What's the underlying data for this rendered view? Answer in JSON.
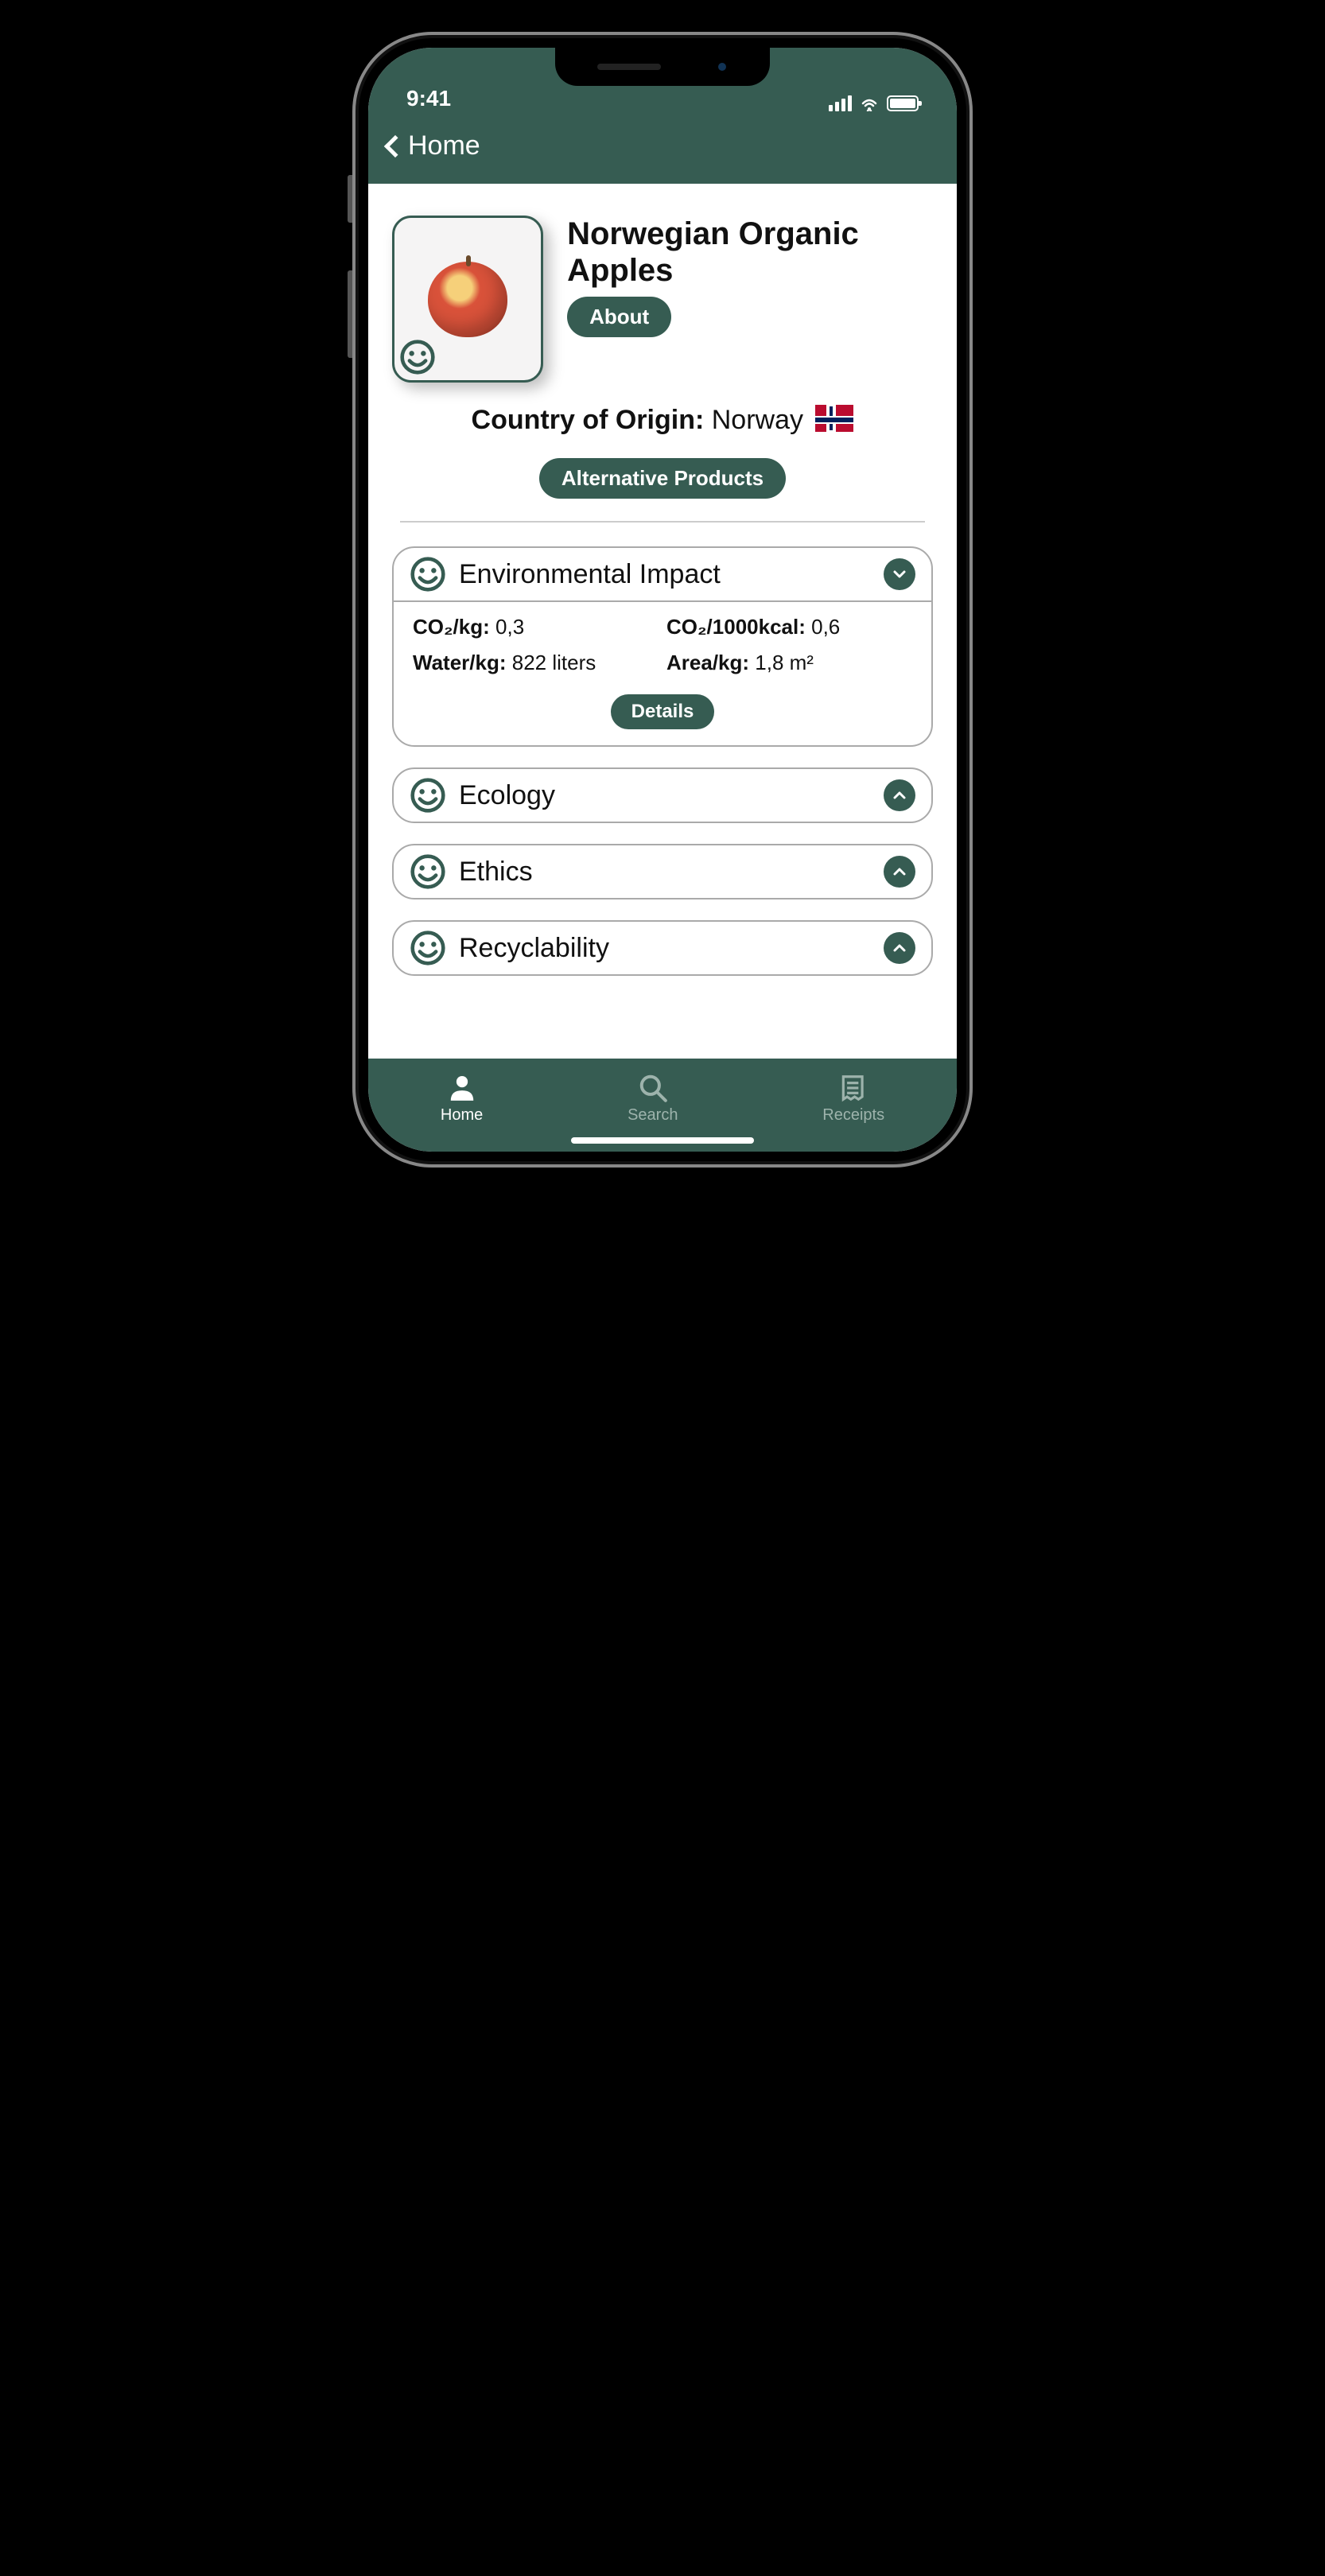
{
  "status": {
    "time": "9:41"
  },
  "nav": {
    "back_label": "Home"
  },
  "product": {
    "title": "Norwegian Organic Apples",
    "about_label": "About",
    "origin_label": "Country of Origin:",
    "origin_value": "Norway",
    "alternatives_label": "Alternative Products"
  },
  "sections": {
    "env": {
      "title": "Environmental Impact",
      "details_label": "Details",
      "stats": {
        "co2kg_label": "CO₂/kg:",
        "co2kg_value": "0,3",
        "co2kcal_label": "CO₂/1000kcal:",
        "co2kcal_value": "0,6",
        "water_label": "Water/kg:",
        "water_value": "822 liters",
        "area_label": "Area/kg:",
        "area_value": "1,8 m²"
      }
    },
    "ecology": {
      "title": "Ecology"
    },
    "ethics": {
      "title": "Ethics"
    },
    "recycle": {
      "title": "Recyclability"
    }
  },
  "tabs": {
    "home": "Home",
    "search": "Search",
    "receipts": "Receipts"
  }
}
